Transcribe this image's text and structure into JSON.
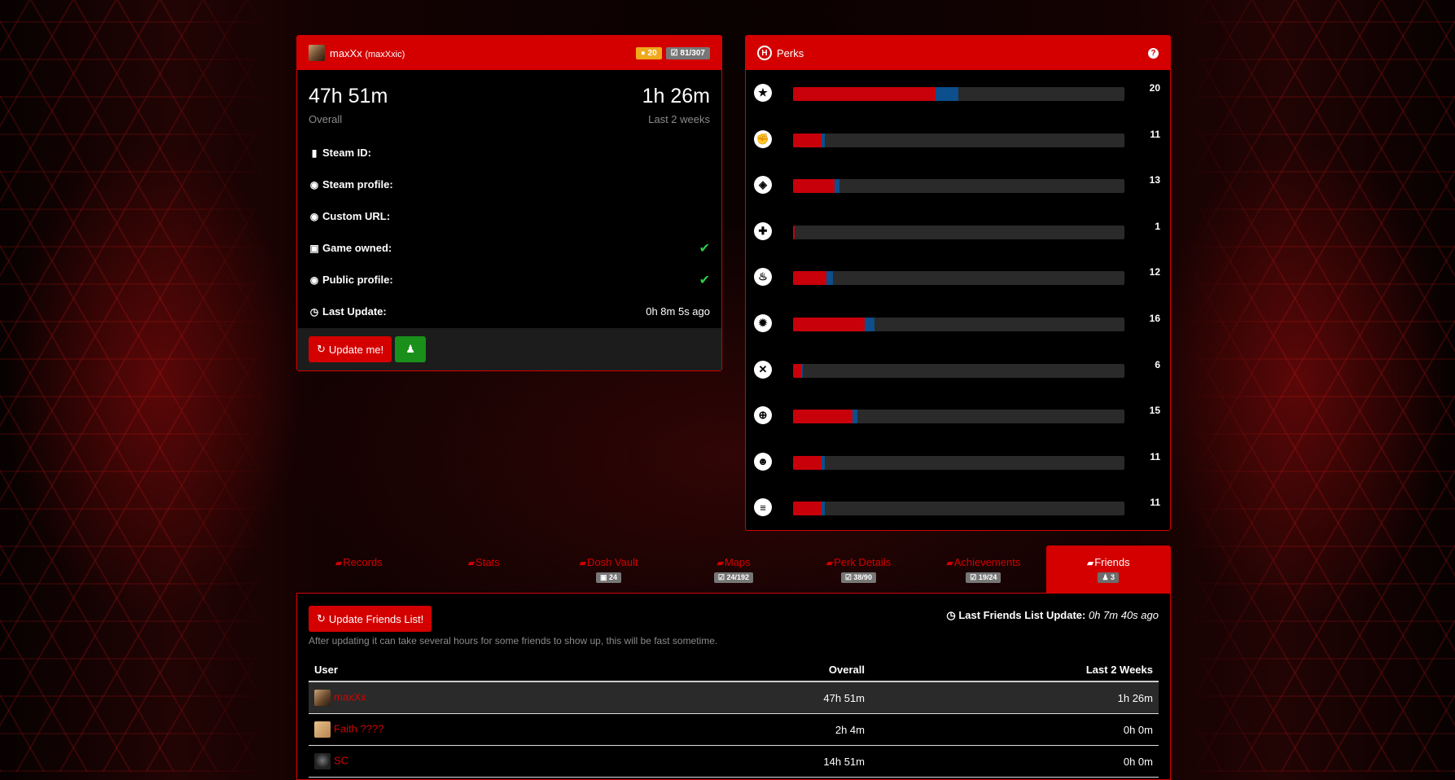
{
  "profile": {
    "name": "maxXx",
    "alias": "(maxXxic)",
    "badge_coins": "20",
    "badge_achievements": "81/307",
    "overall_time": "47h 51m",
    "overall_label": "Overall",
    "recent_time": "1h 26m",
    "recent_label": "Last 2 weeks",
    "rows": [
      {
        "label": "Steam ID:",
        "value": ""
      },
      {
        "label": "Steam profile:",
        "value": ""
      },
      {
        "label": "Custom URL:",
        "value": ""
      },
      {
        "label": "Game owned:",
        "value": "✔"
      },
      {
        "label": "Public profile:",
        "value": "✔"
      },
      {
        "label": "Last Update:",
        "value": "0h 8m 5s ago"
      }
    ],
    "update_button": "Update me!"
  },
  "perks": {
    "title": "Perks",
    "help": "?",
    "items": [
      {
        "icon": "commando-icon",
        "level": "20",
        "progress": 0.43,
        "xp": 0.07
      },
      {
        "icon": "berserker-icon",
        "level": "11",
        "progress": 0.085,
        "xp": 0.01
      },
      {
        "icon": "support-icon",
        "level": "13",
        "progress": 0.125,
        "xp": 0.015
      },
      {
        "icon": "medic-icon",
        "level": "1",
        "progress": 0.005,
        "xp": 0.0
      },
      {
        "icon": "firebug-icon",
        "level": "12",
        "progress": 0.1,
        "xp": 0.02
      },
      {
        "icon": "demolitionist-icon",
        "level": "16",
        "progress": 0.215,
        "xp": 0.03
      },
      {
        "icon": "swat-icon",
        "level": "6",
        "progress": 0.025,
        "xp": 0.005
      },
      {
        "icon": "sharpshooter-icon",
        "level": "15",
        "progress": 0.18,
        "xp": 0.015
      },
      {
        "icon": "gunslinger-icon",
        "level": "11",
        "progress": 0.085,
        "xp": 0.01
      },
      {
        "icon": "survivalist-icon",
        "level": "11",
        "progress": 0.085,
        "xp": 0.01
      }
    ]
  },
  "tabs": [
    {
      "label": "Records",
      "badge": ""
    },
    {
      "label": "Stats",
      "badge": ""
    },
    {
      "label": "Dosh Vault",
      "badge": "24"
    },
    {
      "label": "Maps",
      "badge": "24/192"
    },
    {
      "label": "Perk Details",
      "badge": "38/90"
    },
    {
      "label": "Achievements",
      "badge": "19/24"
    },
    {
      "label": "Friends",
      "badge": "3"
    }
  ],
  "friends": {
    "update_button": "Update Friends List!",
    "last_update_label": "Last Friends List Update:",
    "last_update_value": "0h 7m 40s ago",
    "note": "After updating it can take several hours for some friends to show up, this will be fast sometime.",
    "columns": {
      "user": "User",
      "overall": "Overall",
      "recent": "Last 2 Weeks"
    },
    "rows": [
      {
        "user": "maxXx",
        "overall": "47h 51m",
        "recent": "1h 26m"
      },
      {
        "user": "Faith ????",
        "overall": "2h 4m",
        "recent": "0h 0m"
      },
      {
        "user": "SC",
        "overall": "14h 51m",
        "recent": "0h 0m"
      }
    ]
  },
  "colors": {
    "accent": "#d40000",
    "xp": "#0d4e8c",
    "check": "#2ecc40"
  }
}
